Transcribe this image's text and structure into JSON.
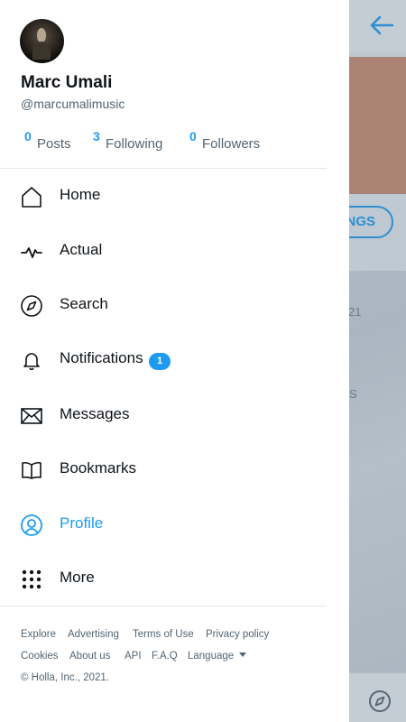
{
  "profile": {
    "name": "Marc Umali",
    "handle": "@marcumalimusic"
  },
  "stats": [
    {
      "count": "0",
      "label": "Posts"
    },
    {
      "count": "3",
      "label": "Following"
    },
    {
      "count": "0",
      "label": "Followers"
    }
  ],
  "nav": [
    {
      "label": "Home",
      "icon": "home-icon"
    },
    {
      "label": "Actual",
      "icon": "activity-icon"
    },
    {
      "label": "Search",
      "icon": "compass-icon"
    },
    {
      "label": "Notifications",
      "icon": "bell-icon",
      "badge": "1"
    },
    {
      "label": "Messages",
      "icon": "envelope-icon"
    },
    {
      "label": "Bookmarks",
      "icon": "book-icon"
    },
    {
      "label": "Profile",
      "icon": "profile-icon",
      "active": true
    },
    {
      "label": "More",
      "icon": "dots-grid-icon"
    }
  ],
  "footer": {
    "row1": [
      "Explore",
      "Advertising",
      "Terms of Use",
      "Privacy policy"
    ],
    "row2": [
      "Cookies",
      "About us",
      "API",
      "F.A.Q"
    ],
    "language": "Language",
    "copyright": "© Holla, Inc., 2021."
  },
  "background": {
    "button_fragment": "NGS",
    "text_fragment_1": "21",
    "text_fragment_2": "S"
  },
  "colors": {
    "accent": "#1d9bf0",
    "text": "#0f1419",
    "muted": "#536471"
  }
}
